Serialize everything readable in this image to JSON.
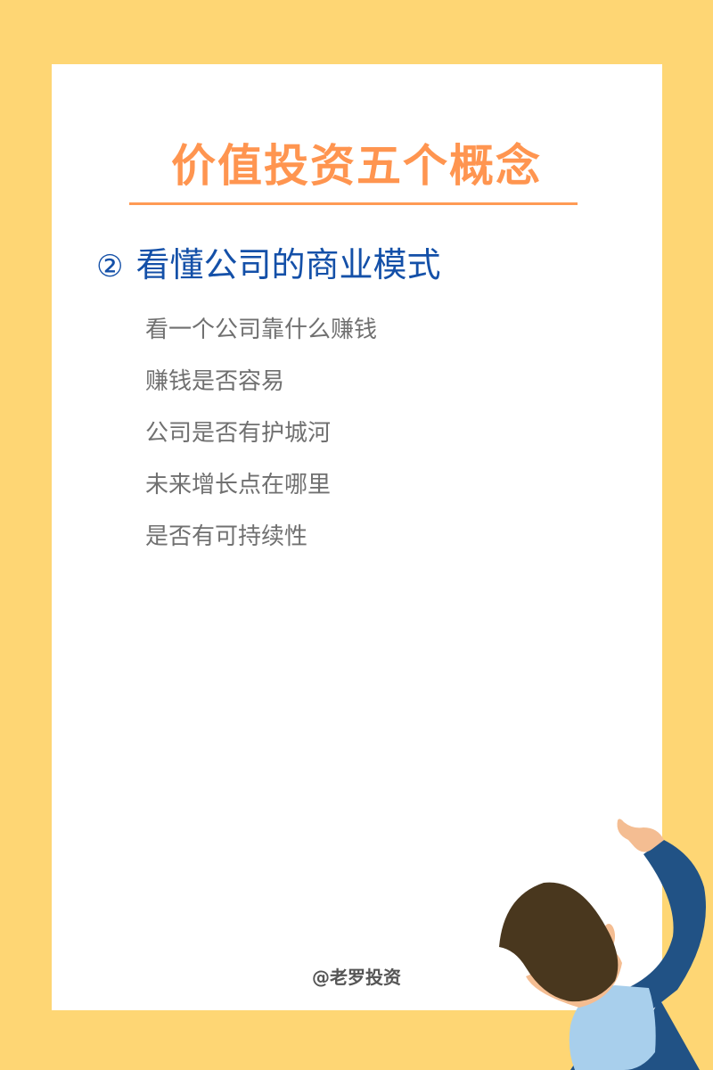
{
  "title": "价值投资五个概念",
  "section": {
    "number": "②",
    "heading": "看懂公司的商业模式"
  },
  "points": [
    "看一个公司靠什么赚钱",
    "赚钱是否容易",
    "公司是否有护城河",
    "未来增长点在哪里",
    "是否有可持续性"
  ],
  "footer": "@老罗投资",
  "colors": {
    "background": "#FED674",
    "title": "#FF9550",
    "heading": "#1450A8",
    "text": "#707070"
  }
}
